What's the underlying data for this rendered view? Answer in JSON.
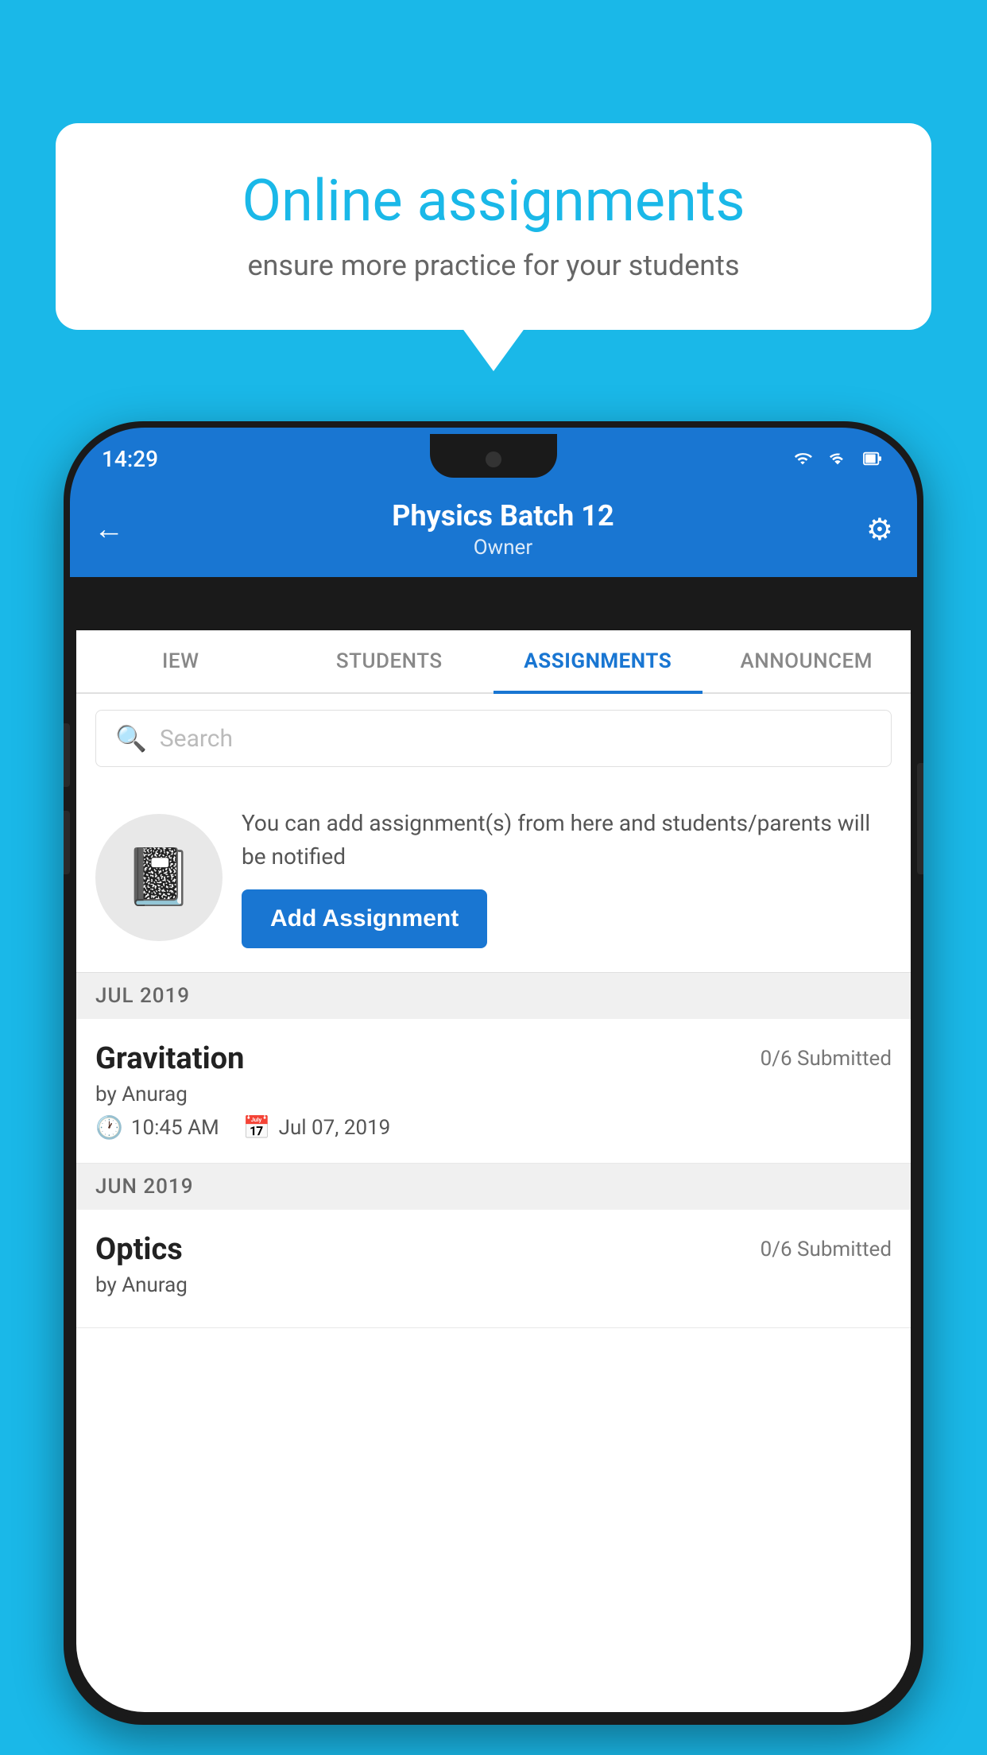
{
  "background_color": "#1ab8e8",
  "speech_bubble": {
    "title": "Online assignments",
    "subtitle": "ensure more practice for your students"
  },
  "status_bar": {
    "time": "14:29"
  },
  "header": {
    "title": "Physics Batch 12",
    "subtitle": "Owner",
    "back_label": "←"
  },
  "tabs": [
    {
      "label": "IEW",
      "active": false
    },
    {
      "label": "STUDENTS",
      "active": false
    },
    {
      "label": "ASSIGNMENTS",
      "active": true
    },
    {
      "label": "ANNOUNCEM",
      "active": false
    }
  ],
  "search": {
    "placeholder": "Search"
  },
  "promo": {
    "description": "You can add assignment(s) from here and students/parents will be notified",
    "button_label": "Add Assignment"
  },
  "sections": [
    {
      "header": "JUL 2019",
      "assignments": [
        {
          "name": "Gravitation",
          "submitted": "0/6 Submitted",
          "by": "by Anurag",
          "time": "10:45 AM",
          "date": "Jul 07, 2019"
        }
      ]
    },
    {
      "header": "JUN 2019",
      "assignments": [
        {
          "name": "Optics",
          "submitted": "0/6 Submitted",
          "by": "by Anurag",
          "time": "",
          "date": ""
        }
      ]
    }
  ]
}
